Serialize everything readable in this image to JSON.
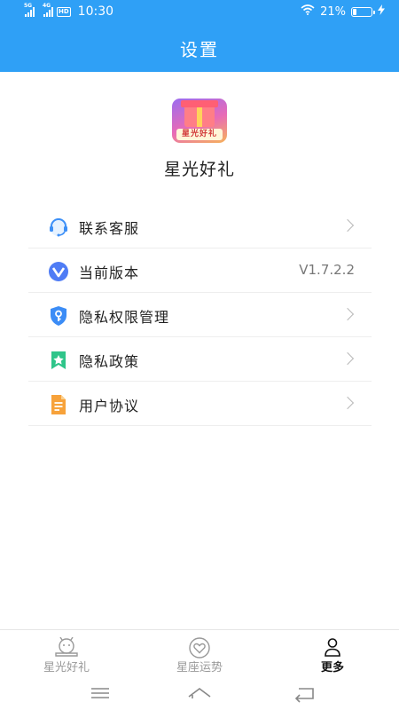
{
  "status_bar": {
    "network1": "5G",
    "network2": "4G",
    "hd_label": "HD",
    "time": "10:30",
    "battery_percent_text": "21%",
    "battery_level": 0.21
  },
  "header": {
    "title": "设置"
  },
  "app": {
    "logo_text": "星光好礼",
    "name": "星光好礼"
  },
  "menu": {
    "items": [
      {
        "label": "联系客服",
        "icon": "headset-icon"
      },
      {
        "label": "当前版本",
        "value": "V1.7.2.2",
        "icon": "version-icon"
      },
      {
        "label": "隐私权限管理",
        "icon": "shield-key-icon"
      },
      {
        "label": "隐私政策",
        "icon": "privacy-star-icon"
      },
      {
        "label": "用户协议",
        "icon": "document-icon"
      }
    ]
  },
  "tabbar": {
    "tabs": [
      {
        "label": "星光好礼",
        "icon": "mascot-icon",
        "active": false
      },
      {
        "label": "星座运势",
        "icon": "heart-circle-icon",
        "active": false
      },
      {
        "label": "更多",
        "icon": "person-icon",
        "active": true
      }
    ]
  },
  "colors": {
    "header_blue": "#2fa0f6",
    "divider": "#eeeeee",
    "tab_inactive": "#999999",
    "tab_active": "#111111"
  }
}
